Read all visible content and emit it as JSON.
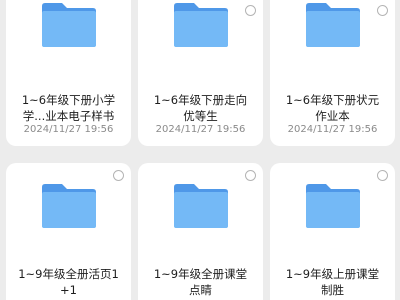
{
  "folders": [
    {
      "title": "1~6年级下册小学\n学...业本电子样书",
      "date": "2024/11/27 19:56"
    },
    {
      "title": "1~6年级下册走向\n优等生",
      "date": "2024/11/27 19:56"
    },
    {
      "title": "1~6年级下册状元\n作业本",
      "date": "2024/11/27 19:56"
    },
    {
      "title": "1~9年级全册活页1\n+1",
      "date": ""
    },
    {
      "title": "1~9年级全册课堂\n点睛",
      "date": ""
    },
    {
      "title": "1~9年级上册课堂\n制胜",
      "date": ""
    }
  ],
  "icons": {
    "folder": "folder-icon",
    "select": "radio-circle"
  },
  "colors": {
    "folder_front": "#6fb6f5",
    "folder_back": "#4f98e8",
    "background": "#ececec"
  }
}
